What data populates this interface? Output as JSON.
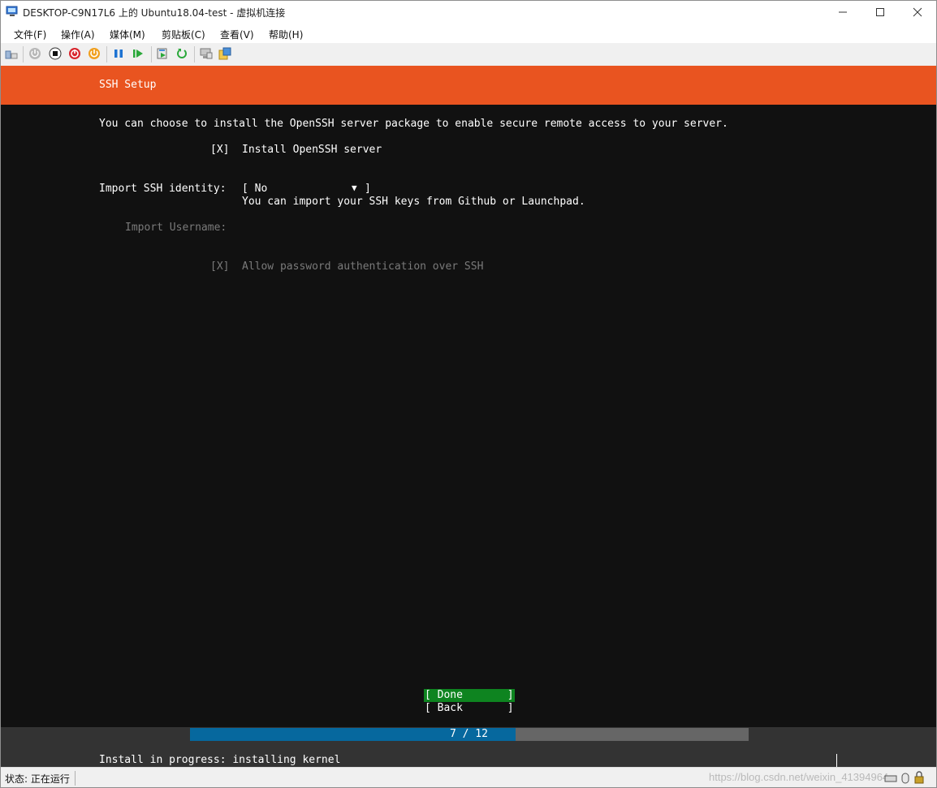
{
  "window": {
    "title": "DESKTOP-C9N17L6 上的 Ubuntu18.04-test - 虚拟机连接",
    "minimize_icon": "minimize-icon",
    "maximize_icon": "maximize-icon",
    "close_icon": "close-icon"
  },
  "menu": [
    "文件(F)",
    "操作(A)",
    "媒体(M)",
    "剪贴板(C)",
    "查看(V)",
    "帮助(H)"
  ],
  "toolbar_icons": [
    "ctrl-alt-del-icon",
    "start-icon",
    "turn-off-icon",
    "shutdown-icon",
    "save-icon",
    "pause-icon",
    "resume-icon",
    "checkpoint-icon",
    "revert-icon",
    "enhanced-session-icon",
    "share-icon"
  ],
  "installer": {
    "header": "SSH Setup",
    "intro": "You can choose to install the OpenSSH server package to enable secure remote access to your server.",
    "install_checkbox": "[X]",
    "install_label": "Install OpenSSH server",
    "identity_label": "Import SSH identity:",
    "identity_open": "[ No",
    "identity_arrow": "▼",
    "identity_close": "]",
    "identity_help": "You can import your SSH keys from Github or Launchpad.",
    "username_label": "Import Username:",
    "password_checkbox": "[X]",
    "password_label": "Allow password authentication over SSH",
    "done_label": "[ Done       ]",
    "back_label": "[ Back       ]",
    "progress_text": "7 / 12",
    "progress_fraction": 0.5833,
    "status_line": "Install in progress: installing kernel"
  },
  "colors": {
    "ubuntu_orange": "#e95420",
    "done_green": "#0e8420",
    "progress_blue": "#06689e"
  },
  "statusbar": {
    "state": "状态: 正在运行",
    "watermark": "https://blog.csdn.net/weixin_41394964"
  }
}
